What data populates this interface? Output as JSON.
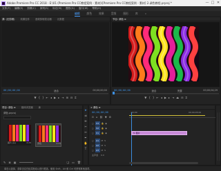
{
  "titlebar": {
    "title": "Adobe Premiere Pro CC 2018 - E:\\01 (Premiere Pro CC教程案例 - 素材)\\[Premiere Pro CC教程案例 - 素材] 2.调色教程.prproj *",
    "minimize": "—",
    "maximize": "□",
    "close": "✕"
  },
  "menu": [
    "文件(F)",
    "编辑(E)",
    "剪辑(C)",
    "序列(S)",
    "标记(M)",
    "图形(G)",
    "窗口(W)",
    "帮助(H)"
  ],
  "workspaces": [
    "编辑",
    "颜色",
    "效果",
    "音频",
    "图形",
    "库",
    "»"
  ],
  "active_workspace": "编辑",
  "source_panel": {
    "tabs": [
      "源: (无剪辑)",
      "效果控件",
      "音频剪辑混合器",
      "元数据"
    ],
    "timecode_left": "00;00;00;00",
    "fit_label": "适合",
    "timecode_right": "00;00;00;00"
  },
  "program_panel": {
    "tabs": [
      "节目: 调色 ≡"
    ],
    "timecode_left": "00;00;00;00",
    "fit_label": "适合",
    "quality_label": "完整",
    "timecode_right": "00;00;04;29"
  },
  "project_panel": {
    "tabs": [
      "项目: 调色 ≡",
      "媒体浏览器",
      "库"
    ],
    "project_name": "调色.prproj",
    "search_placeholder": "",
    "items": [
      {
        "name": "图片.jpg",
        "duration": "4:29"
      },
      {
        "name": "调色",
        "duration": "4:29"
      }
    ]
  },
  "timeline_panel": {
    "tab": "× 调色 ≡",
    "timecode": "00;00;00;00",
    "ruler_start": ":00;00",
    "ruler_mid": "00;00;05;00",
    "video_tracks": [
      "V3",
      "V2",
      "V1"
    ],
    "audio_tracks": [
      "A1",
      "A2",
      "A3"
    ],
    "master_label": "主声道",
    "master_value": "0.0",
    "clip_label": "fx 图片"
  },
  "status": {
    "text": "单击以选择，或单击空白处并拖动以进行框选。使用 Shift、Alt 和 Ctrl 可获得其他选项。"
  },
  "colors": {
    "accent": "#3c8fe0",
    "clip": "#c88ad8",
    "track_label": "#2b4a76"
  }
}
